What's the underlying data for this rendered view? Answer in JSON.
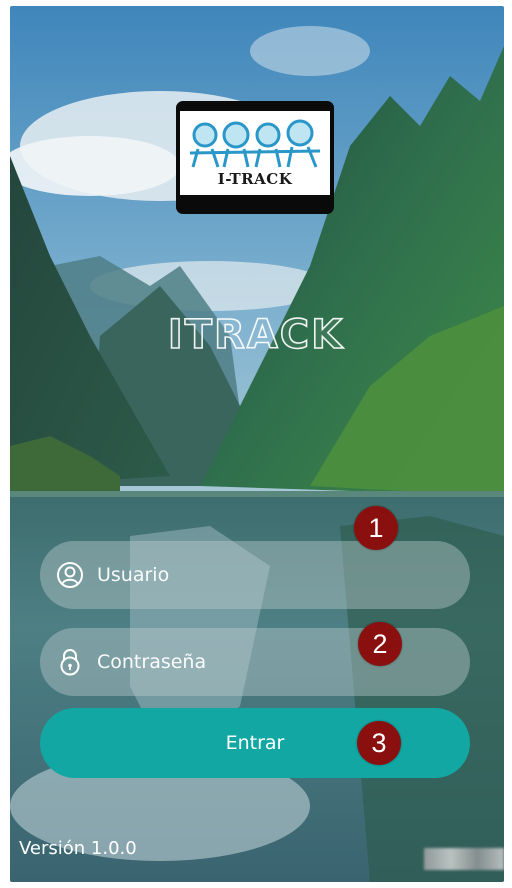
{
  "logo": {
    "text": "I-TRACK"
  },
  "app_title": "ITRACK",
  "form": {
    "username_placeholder": "Usuario",
    "password_placeholder": "Contraseña",
    "submit_label": "Entrar"
  },
  "annotations": [
    "1",
    "2",
    "3"
  ],
  "footer": {
    "version": "Versión 1.0.0"
  },
  "colors": {
    "accent": "#12a7a3",
    "badge": "#8a0f0f"
  },
  "icons": {
    "username": "user-circle-icon",
    "password": "lock-icon"
  }
}
